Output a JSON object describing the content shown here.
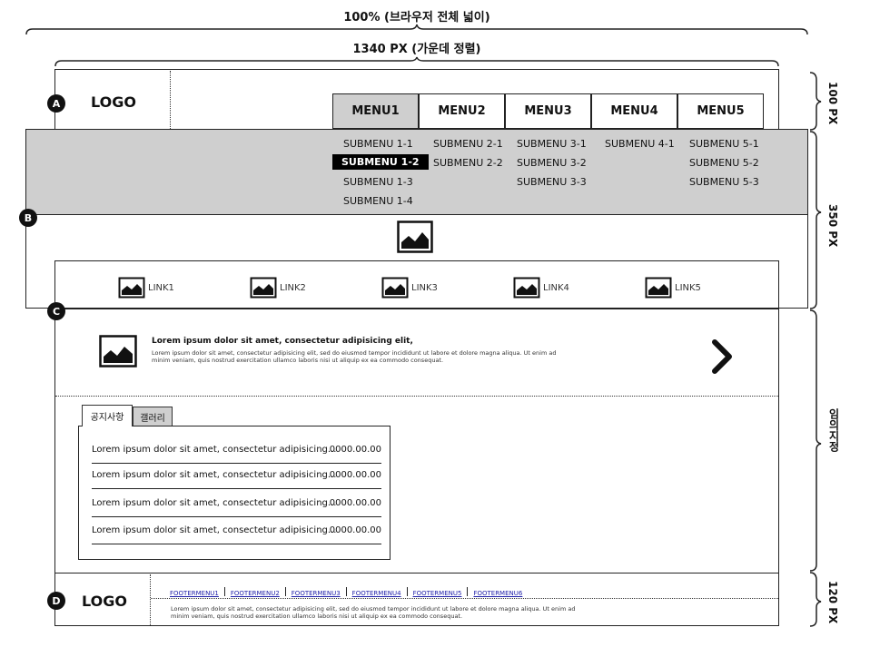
{
  "dimensions": {
    "full_width": "100% (브라우저 전체 넓이)",
    "content_width": "1340 PX (가운데 정렬)",
    "header_height": "100 PX",
    "visual_height": "350 PX",
    "main_height": "임의지정",
    "footer_height": "120 PX"
  },
  "badges": {
    "a": "A",
    "b": "B",
    "c": "C",
    "d": "D"
  },
  "header": {
    "logo": "LOGO",
    "menus": [
      "MENU1",
      "MENU2",
      "MENU3",
      "MENU4",
      "MENU5"
    ]
  },
  "submenus": {
    "menu1": [
      "SUBMENU 1-1",
      "SUBMENU 1-2",
      "SUBMENU 1-3",
      "SUBMENU 1-4"
    ],
    "menu2": [
      "SUBMENU 2-1",
      "SUBMENU 2-2"
    ],
    "menu3": [
      "SUBMENU 3-1",
      "SUBMENU 3-2",
      "SUBMENU 3-3"
    ],
    "menu4": [
      "SUBMENU 4-1"
    ],
    "menu5": [
      "SUBMENU 5-1",
      "SUBMENU 5-2",
      "SUBMENU 5-3"
    ]
  },
  "quick_links": [
    "LINK1",
    "LINK2",
    "LINK3",
    "LINK4",
    "LINK5"
  ],
  "banner": {
    "title": "Lorem ipsum dolor sit amet, consectetur adipisicing elit,",
    "body_line1": "Lorem ipsum dolor sit amet, consectetur adipisicing elit, sed do eiusmod tempor incididunt ut labore et dolore magna aliqua. Ut enim ad",
    "body_line2": "minim veniam, quis nostrud exercitation ullamco laboris nisi ut aliquip ex ea commodo consequat."
  },
  "tabs": [
    "공지사항",
    "갤러리"
  ],
  "notices": [
    {
      "title": "Lorem ipsum dolor sit amet, consectetur adipisicing...",
      "date": "0000.00.00"
    },
    {
      "title": "Lorem ipsum dolor sit amet, consectetur adipisicing...",
      "date": "0000.00.00"
    },
    {
      "title": "Lorem ipsum dolor sit amet, consectetur adipisicing...",
      "date": "0000.00.00"
    },
    {
      "title": "Lorem ipsum dolor sit amet, consectetur adipisicing...",
      "date": "0000.00.00"
    }
  ],
  "footer": {
    "logo": "LOGO",
    "menus": [
      "FOOTERMENU1",
      "FOOTERMENU2",
      "FOOTERMENU3",
      "FOOTERMENU4",
      "FOOTERMENU5",
      "FOOTERMENU6"
    ],
    "text_line1": "Lorem ipsum dolor sit amet, consectetur adipisicing elit, sed do eiusmod tempor incididunt ut labore et dolore magna aliqua. Ut enim ad",
    "text_line2": "minim veniam, quis nostrud exercitation ullamco laboris nisi ut aliquip ex ea commodo consequat."
  }
}
